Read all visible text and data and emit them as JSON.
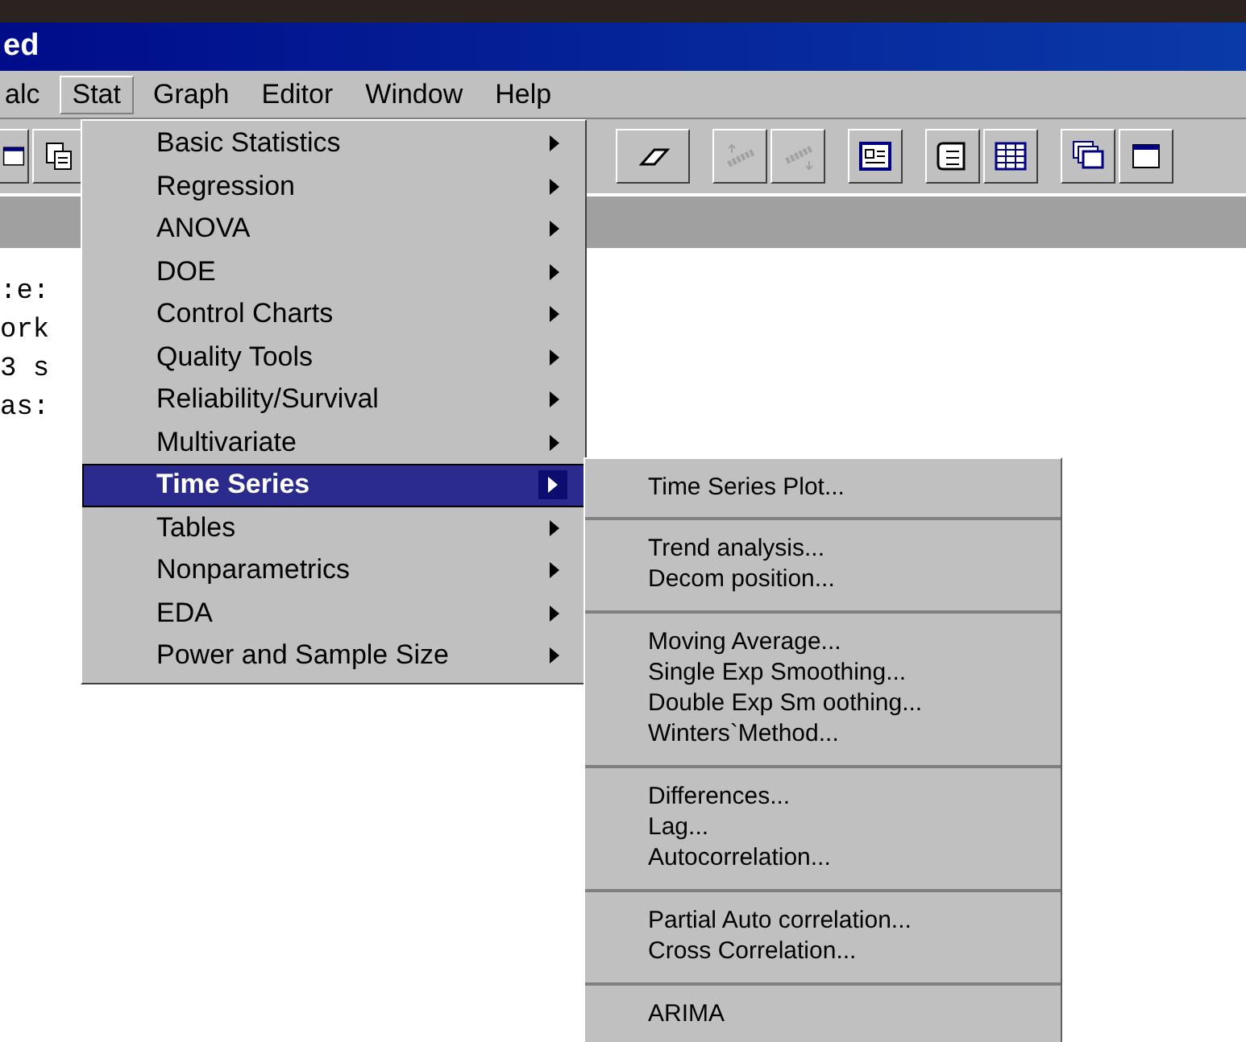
{
  "window": {
    "title": "ed"
  },
  "menubar": [
    {
      "label": "alc",
      "selected": false
    },
    {
      "label": "Stat",
      "selected": true
    },
    {
      "label": "Graph",
      "selected": false
    },
    {
      "label": "Editor",
      "selected": false
    },
    {
      "label": "Window",
      "selected": false
    },
    {
      "label": "Help",
      "selected": false
    }
  ],
  "toolbar": [
    {
      "kind": "frame",
      "disabled": false
    },
    {
      "kind": "document",
      "disabled": false
    },
    {
      "kind": "eraser",
      "disabled": false
    },
    {
      "kind": "link-up",
      "disabled": true
    },
    {
      "kind": "link-down",
      "disabled": true
    },
    {
      "kind": "panel",
      "disabled": false
    },
    {
      "kind": "scroll",
      "disabled": false
    },
    {
      "kind": "grid",
      "disabled": false
    },
    {
      "kind": "stack",
      "disabled": false
    },
    {
      "kind": "frame",
      "disabled": false
    }
  ],
  "session_lines": [
    ":e:",
    "ork",
    "3 s",
    "as:"
  ],
  "stat_menu": {
    "items": [
      {
        "label": "Basic Statistics",
        "selected": false
      },
      {
        "label": "Regression",
        "selected": false
      },
      {
        "label": "ANOVA",
        "selected": false
      },
      {
        "label": "DOE",
        "selected": false
      },
      {
        "label": "Control Charts",
        "selected": false
      },
      {
        "label": "Quality Tools",
        "selected": false
      },
      {
        "label": "Reliability/Survival",
        "selected": false
      },
      {
        "label": "Multivariate",
        "selected": false
      },
      {
        "label": "Time Series",
        "selected": true
      },
      {
        "label": "Tables",
        "selected": false
      },
      {
        "label": "Nonparametrics",
        "selected": false
      },
      {
        "label": "EDA",
        "selected": false
      },
      {
        "label": "Power and Sample Size",
        "selected": false
      }
    ]
  },
  "time_series_menu": {
    "groups": [
      [
        "Time Series Plot..."
      ],
      [
        "Trend analysis...",
        "Decom position..."
      ],
      [
        "Moving Average...",
        "Single Exp Smoothing...",
        "Double Exp Sm oothing...",
        "Winters`Method..."
      ],
      [
        "Differences...",
        "Lag...",
        "Autocorrelation..."
      ],
      [
        "Partial Auto correlation...",
        "Cross Correlation..."
      ],
      [
        "ARIMA"
      ]
    ]
  }
}
